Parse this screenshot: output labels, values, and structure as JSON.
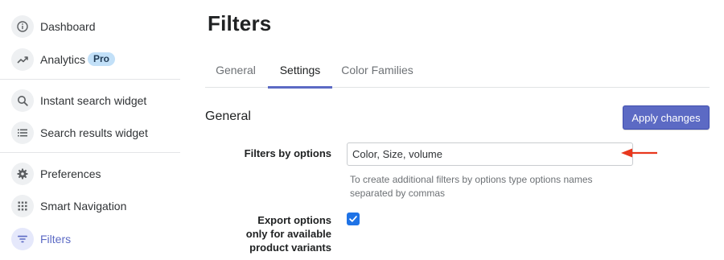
{
  "sidebar": {
    "items": [
      {
        "label": "Dashboard",
        "icon": "info-icon"
      },
      {
        "label": "Analytics",
        "icon": "trend-up-icon",
        "badge": "Pro"
      },
      {
        "label": "Instant search widget",
        "icon": "search-icon"
      },
      {
        "label": "Search results widget",
        "icon": "list-icon"
      },
      {
        "label": "Preferences",
        "icon": "gear-icon"
      },
      {
        "label": "Smart Navigation",
        "icon": "grid-dots-icon"
      },
      {
        "label": "Filters",
        "icon": "filter-icon",
        "active": true
      }
    ]
  },
  "page": {
    "title": "Filters"
  },
  "tabs": [
    {
      "label": "General"
    },
    {
      "label": "Settings",
      "active": true
    },
    {
      "label": "Color Families"
    }
  ],
  "section": {
    "title": "General",
    "apply_label": "Apply changes"
  },
  "filters_by_options": {
    "label": "Filters by options",
    "value": "Color, Size, volume",
    "help": "To create additional filters by options type options names separated by commas"
  },
  "export_options": {
    "label_line1": "Export options",
    "label_line2": "only for available",
    "label_line3": "product variants",
    "checked": true
  },
  "colors": {
    "accent": "#5c6ac4",
    "checkbox": "#1f73e6",
    "annotation_arrow": "#e8381e"
  }
}
